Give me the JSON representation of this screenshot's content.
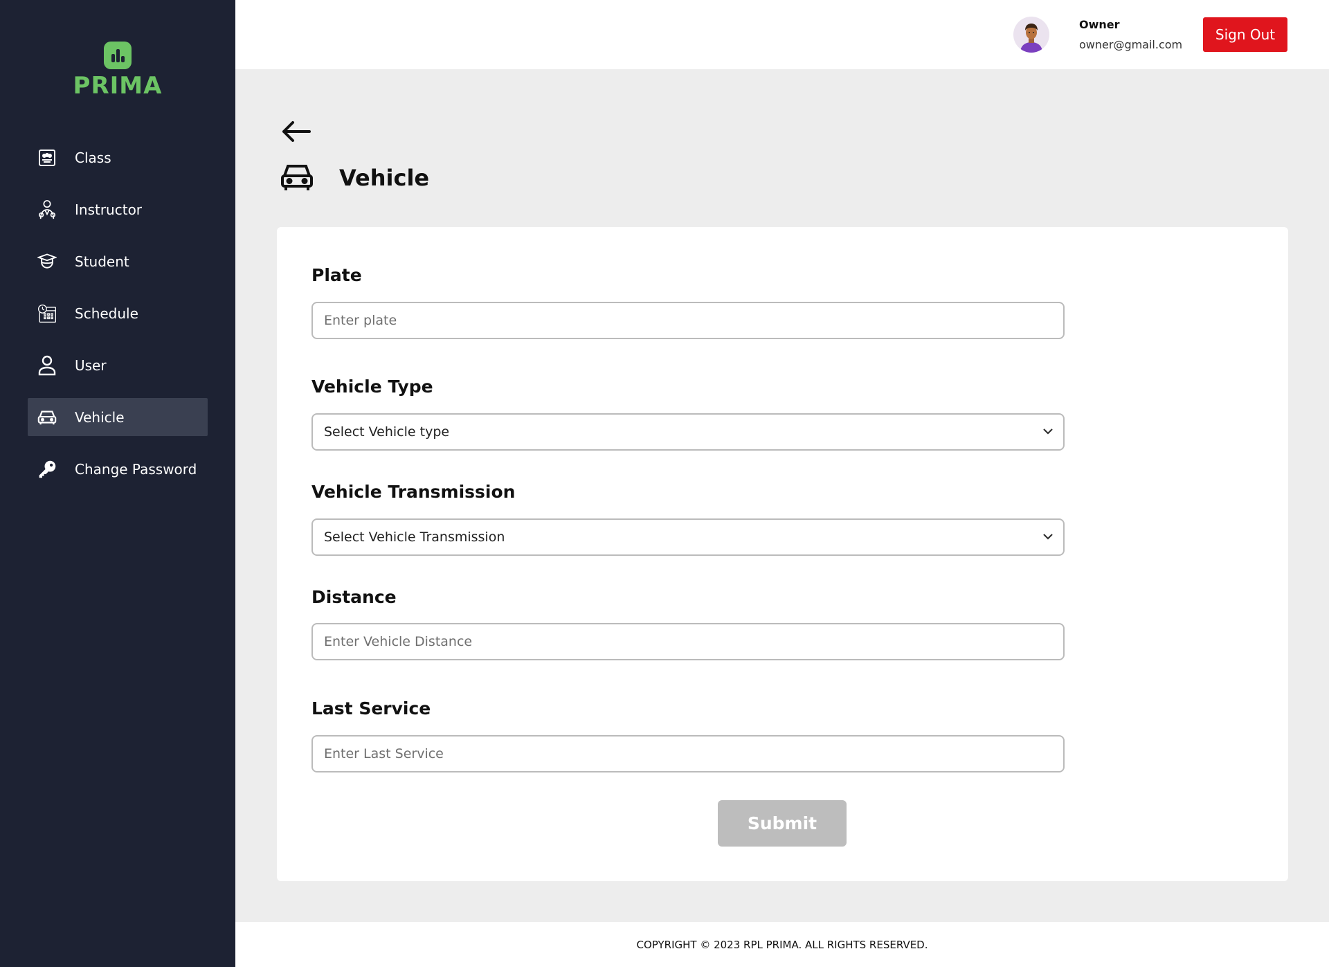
{
  "brand": {
    "name": "PRIMA",
    "color": "#6cc464"
  },
  "sidebar": {
    "items": [
      {
        "label": "Class",
        "icon": "class-board-icon"
      },
      {
        "label": "Instructor",
        "icon": "instructor-icon"
      },
      {
        "label": "Student",
        "icon": "graduation-cap-icon"
      },
      {
        "label": "Schedule",
        "icon": "calendar-clock-icon"
      },
      {
        "label": "User",
        "icon": "user-icon"
      },
      {
        "label": "Vehicle",
        "icon": "car-icon",
        "active": true
      },
      {
        "label": "Change Password",
        "icon": "key-icon"
      }
    ]
  },
  "header": {
    "user_name": "Owner",
    "user_email": "owner@gmail.com",
    "signout_label": "Sign Out",
    "signout_color": "#e0151d"
  },
  "page": {
    "title": "Vehicle"
  },
  "form": {
    "plate_label": "Plate",
    "plate_placeholder": "Enter plate",
    "type_label": "Vehicle Type",
    "type_value": "Select Vehicle type",
    "transmission_label": "Vehicle Transmission",
    "transmission_value": "Select Vehicle Transmission",
    "distance_label": "Distance",
    "distance_placeholder": "Enter Vehicle Distance",
    "last_service_label": "Last Service",
    "last_service_placeholder": "Enter Last Service",
    "submit_label": "Submit"
  },
  "footer": {
    "text": "COPYRIGHT © 2023 RPL PRIMA. ALL RIGHTS RESERVED."
  }
}
